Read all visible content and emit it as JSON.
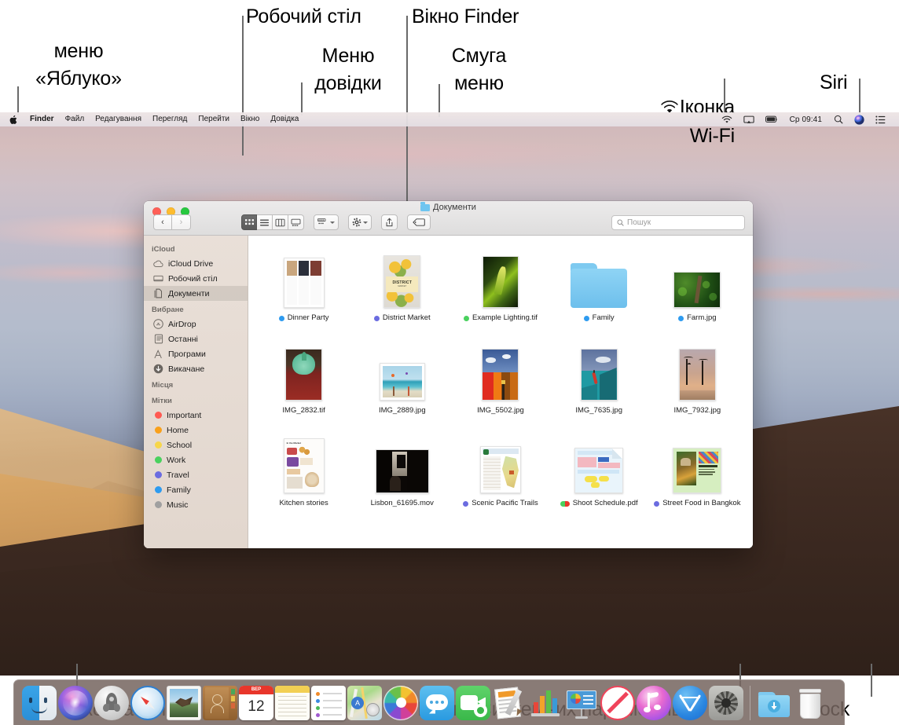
{
  "callouts": [
    {
      "id": "apple-menu",
      "text": "меню\n«Яблуко»"
    },
    {
      "id": "desktop",
      "text": "Робочий стіл"
    },
    {
      "id": "help-menu",
      "text": "Меню\nдовідки"
    },
    {
      "id": "finder-window",
      "text": "Вікно Finder"
    },
    {
      "id": "menu-bar",
      "text": "Смуга\nменю"
    },
    {
      "id": "wifi-icon",
      "text": "Іконка\nWi-Fi"
    },
    {
      "id": "siri",
      "text": "Siri"
    },
    {
      "id": "finder-icon",
      "text": "Іконка Finder"
    },
    {
      "id": "system-prefs-icon",
      "text": "Іконка Системних параметрів"
    },
    {
      "id": "dock",
      "text": "Dock"
    }
  ],
  "menubar": {
    "apple_icon": "apple-icon",
    "items": [
      "Finder",
      "Файл",
      "Редагування",
      "Перегляд",
      "Перейти",
      "Вікно",
      "Довідка"
    ],
    "status": {
      "wifi": "wifi-icon",
      "airplay": "airplay-icon",
      "battery": "battery-icon",
      "clock": "Ср 09:41",
      "search": "search-icon",
      "siri": "siri-icon",
      "control_center": "list-icon"
    }
  },
  "finder": {
    "title": "Документи",
    "traffic_lights": [
      "close",
      "minimize",
      "zoom"
    ],
    "nav": {
      "back": "‹",
      "forward": "›"
    },
    "view_buttons": [
      "icon-view",
      "list-view",
      "column-view",
      "gallery-view"
    ],
    "toolbar_buttons": [
      "group-by",
      "action-gear",
      "share",
      "tag"
    ],
    "search": {
      "placeholder": "Пошук",
      "value": ""
    },
    "sidebar": [
      {
        "type": "header",
        "label": "iCloud"
      },
      {
        "type": "item",
        "label": "iCloud Drive",
        "icon": "cloud-icon",
        "selected": false
      },
      {
        "type": "item",
        "label": "Робочий стіл",
        "icon": "desktop-icon",
        "selected": false
      },
      {
        "type": "item",
        "label": "Документи",
        "icon": "documents-icon",
        "selected": true
      },
      {
        "type": "header",
        "label": "Вибране"
      },
      {
        "type": "item",
        "label": "AirDrop",
        "icon": "airdrop-icon",
        "selected": false
      },
      {
        "type": "item",
        "label": "Останні",
        "icon": "recents-icon",
        "selected": false
      },
      {
        "type": "item",
        "label": "Програми",
        "icon": "applications-icon",
        "selected": false
      },
      {
        "type": "item",
        "label": "Викачане",
        "icon": "downloads-icon",
        "selected": false
      },
      {
        "type": "header",
        "label": "Місця"
      },
      {
        "type": "header",
        "label": "Мітки"
      },
      {
        "type": "tag",
        "label": "Important",
        "color": "#ff5a52"
      },
      {
        "type": "tag",
        "label": "Home",
        "color": "#f9a01b"
      },
      {
        "type": "tag",
        "label": "School",
        "color": "#f7d64a"
      },
      {
        "type": "tag",
        "label": "Work",
        "color": "#4ad15e"
      },
      {
        "type": "tag",
        "label": "Travel",
        "color": "#6b6ce0"
      },
      {
        "type": "tag",
        "label": "Family",
        "color": "#2e9bf0"
      },
      {
        "type": "tag",
        "label": "Music",
        "color": "#a0a0a0"
      }
    ],
    "files": [
      {
        "name": "Dinner Party",
        "kind": "recipe-doc",
        "tag": "#2e9bf0"
      },
      {
        "name": "District Market",
        "kind": "poster-lemons",
        "tag": "#6b6ce0"
      },
      {
        "name": "Example Lighting.tif",
        "kind": "photo-plant",
        "tag": "#4ad15e"
      },
      {
        "name": "Family",
        "kind": "folder",
        "tag": "#2e9bf0"
      },
      {
        "name": "Farm.jpg",
        "kind": "photo-farm",
        "tag": "#2e9bf0"
      },
      {
        "name": "IMG_2832.tif",
        "kind": "photo-hat",
        "tag": null
      },
      {
        "name": "IMG_2889.jpg",
        "kind": "photo-beach",
        "tag": null
      },
      {
        "name": "IMG_5502.jpg",
        "kind": "photo-colorwall",
        "tag": null
      },
      {
        "name": "IMG_7635.jpg",
        "kind": "photo-jump",
        "tag": null
      },
      {
        "name": "IMG_7932.jpg",
        "kind": "photo-palms",
        "tag": null
      },
      {
        "name": "Kitchen stories",
        "kind": "market-doc",
        "tag": null
      },
      {
        "name": "Lisbon_61695.mov",
        "kind": "video-dark",
        "tag": null
      },
      {
        "name": "Scenic Pacific Trails",
        "kind": "map-doc",
        "tag": "#6b6ce0"
      },
      {
        "name": "Shoot Schedule.pdf",
        "kind": "pdf-schedule",
        "tag": "dual"
      },
      {
        "name": "Street Food in Bangkok",
        "kind": "green-poster",
        "tag": "#6b6ce0"
      }
    ]
  },
  "dock": {
    "items": [
      {
        "name": "Finder",
        "icon": "finder-icon"
      },
      {
        "name": "Siri",
        "icon": "siri-icon"
      },
      {
        "name": "Launchpad",
        "icon": "launchpad-icon"
      },
      {
        "name": "Safari",
        "icon": "safari-icon"
      },
      {
        "name": "Mail",
        "icon": "mail-icon"
      },
      {
        "name": "Contacts",
        "icon": "contacts-icon"
      },
      {
        "name": "Calendar",
        "icon": "calendar-icon",
        "day": "12",
        "month": "ВЕР"
      },
      {
        "name": "Notes",
        "icon": "notes-icon"
      },
      {
        "name": "Reminders",
        "icon": "reminders-icon"
      },
      {
        "name": "Maps",
        "icon": "maps-icon"
      },
      {
        "name": "Photos",
        "icon": "photos-icon"
      },
      {
        "name": "Messages",
        "icon": "messages-icon"
      },
      {
        "name": "FaceTime",
        "icon": "facetime-icon"
      },
      {
        "name": "Pages",
        "icon": "pages-icon"
      },
      {
        "name": "Numbers",
        "icon": "numbers-icon"
      },
      {
        "name": "Keynote",
        "icon": "keynote-icon"
      },
      {
        "name": "News",
        "icon": "news-icon"
      },
      {
        "name": "iTunes",
        "icon": "itunes-icon"
      },
      {
        "name": "App Store",
        "icon": "appstore-icon"
      },
      {
        "name": "System Preferences",
        "icon": "system-preferences-icon"
      },
      {
        "name": "Downloads",
        "icon": "downloads-folder-icon"
      },
      {
        "name": "Trash",
        "icon": "trash-icon"
      }
    ]
  },
  "colors": {
    "accent": "#2e9bf0",
    "menubar_bg": "#efe9e9",
    "sidebar_bg": "#e8ded6",
    "dock_bg": "#76655f"
  }
}
